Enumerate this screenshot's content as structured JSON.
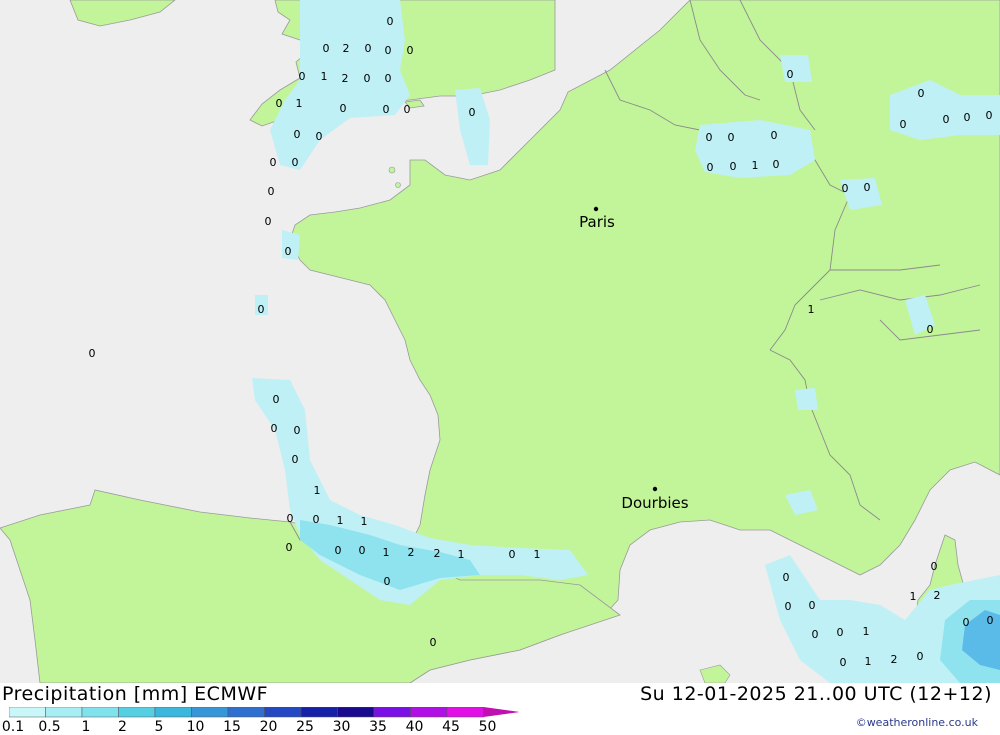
{
  "title": "Precipitation [mm] ECMWF",
  "datetime": "Su 12-01-2025 21..00 UTC (12+12)",
  "credit": "©weatheronline.co.uk",
  "colors": {
    "sea": "#eeeeee",
    "land": "#c2f59a",
    "border": "#9a9a9a",
    "precip_light": "#bff0f5",
    "precip_mid": "#8ee3ee",
    "precip_heavy": "#5bbbe8"
  },
  "cities": [
    {
      "name": "Paris"
    },
    {
      "name": "Dourbies"
    }
  ],
  "legend": {
    "ticks": [
      "0.1",
      "0.5",
      "1",
      "2",
      "5",
      "10",
      "15",
      "20",
      "25",
      "30",
      "35",
      "40",
      "45",
      "50"
    ],
    "colors": [
      "#c9f6f8",
      "#a6eef3",
      "#7fe2ec",
      "#57cfe3",
      "#3bb6dc",
      "#3796d6",
      "#2f6fd0",
      "#2447c4",
      "#1522a8",
      "#1a0a90",
      "#7a10e6",
      "#b010e6",
      "#e010e6",
      "#c010b0"
    ]
  },
  "labels": [
    "0",
    "0",
    "2",
    "0",
    "0",
    "0",
    "0",
    "1",
    "2",
    "0",
    "0",
    "0",
    "1",
    "0",
    "0",
    "0",
    "0",
    "0",
    "0",
    "0",
    "0",
    "0",
    "0",
    "0",
    "0",
    "0",
    "0",
    "0",
    "0",
    "0",
    "1",
    "0",
    "0",
    "0",
    "1",
    "1",
    "0",
    "0",
    "1",
    "2",
    "2",
    "1",
    "0",
    "1",
    "0",
    "0",
    "0",
    "0",
    "0",
    "0",
    "0",
    "0",
    "0",
    "0",
    "0",
    "0",
    "0",
    "1",
    "0",
    "0",
    "0",
    "1",
    "0",
    "0",
    "0",
    "0",
    "0",
    "0",
    "1",
    "0",
    "1",
    "2",
    "0",
    "1",
    "2",
    "0",
    "0",
    "0"
  ]
}
